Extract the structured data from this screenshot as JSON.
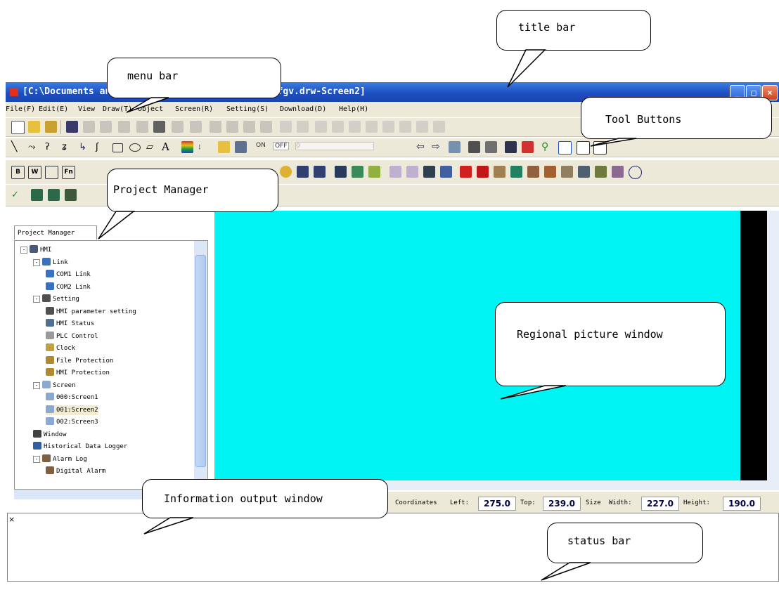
{
  "window": {
    "title": "[C:\\Documents and Settings\\Administrator\\桌面\\cfgv.drw-Screen2]",
    "controls": [
      "minimize",
      "maximize",
      "close"
    ]
  },
  "menu": {
    "items": [
      "File(F)",
      "Edit(E)",
      "View",
      "Draw(T)",
      "Object",
      "Screen(R)",
      "Setting(S)",
      "Download(D)",
      "Help(H)"
    ]
  },
  "toolbar": {
    "on_label": "ON",
    "off_label": "OFF",
    "zero_label": "0"
  },
  "project_manager": {
    "tab_label": "Project Manager",
    "tree": [
      {
        "label": "HMI",
        "level": 0,
        "expand": "-",
        "icon": "hmi-icon"
      },
      {
        "label": "Link",
        "level": 1,
        "expand": "-",
        "icon": "link-icon"
      },
      {
        "label": "COM1 Link",
        "level": 2,
        "icon": "link-icon"
      },
      {
        "label": "COM2 Link",
        "level": 2,
        "icon": "link-icon"
      },
      {
        "label": "Setting",
        "level": 1,
        "expand": "-",
        "icon": "database-icon"
      },
      {
        "label": "HMI parameter setting",
        "level": 2,
        "icon": "database-icon"
      },
      {
        "label": "HMI Status",
        "level": 2,
        "icon": "status-icon"
      },
      {
        "label": "PLC Control",
        "level": 2,
        "icon": "plc-icon"
      },
      {
        "label": "Clock",
        "level": 2,
        "icon": "clock-icon"
      },
      {
        "label": "File Protection",
        "level": 2,
        "icon": "key-icon"
      },
      {
        "label": "HMI Protection",
        "level": 2,
        "icon": "key-icon"
      },
      {
        "label": "Screen",
        "level": 1,
        "expand": "-",
        "icon": "screen-icon"
      },
      {
        "label": "000:Screen1",
        "level": 2,
        "icon": "screen-icon"
      },
      {
        "label": "001:Screen2",
        "level": 2,
        "icon": "screen-icon"
      },
      {
        "label": "002:Screen3",
        "level": 2,
        "icon": "screen-icon"
      },
      {
        "label": "Window",
        "level": 1,
        "icon": "window-icon"
      },
      {
        "label": "Historical Data Logger",
        "level": 1,
        "icon": "logger-icon"
      },
      {
        "label": "Alarm Log",
        "level": 1,
        "expand": "-",
        "icon": "alarm-icon"
      },
      {
        "label": "Digital Alarm",
        "level": 2,
        "icon": "alarm-icon"
      }
    ]
  },
  "coordinates": {
    "coordinates_label": "Coordinates",
    "left_label": "Left:",
    "left_value": "275.0",
    "top_label": "Top:",
    "top_value": "239.0",
    "size_label": "Size",
    "width_label": "Width:",
    "width_value": "227.0",
    "height_label": "Height:",
    "height_value": "190.0"
  },
  "info_output": {
    "close_glyph": "×"
  },
  "annotations": {
    "title_bar": "title bar",
    "menu_bar": "menu bar",
    "tool_buttons": "Tool Buttons",
    "project_manager": "Project Manager",
    "regional_picture_window": "Regional picture window",
    "information_output_window": "Information output window",
    "status_bar": "status bar"
  },
  "colors": {
    "canvas": "#00f4f4",
    "title_bar": "#1d4fc2",
    "chrome": "#ece9d8"
  }
}
